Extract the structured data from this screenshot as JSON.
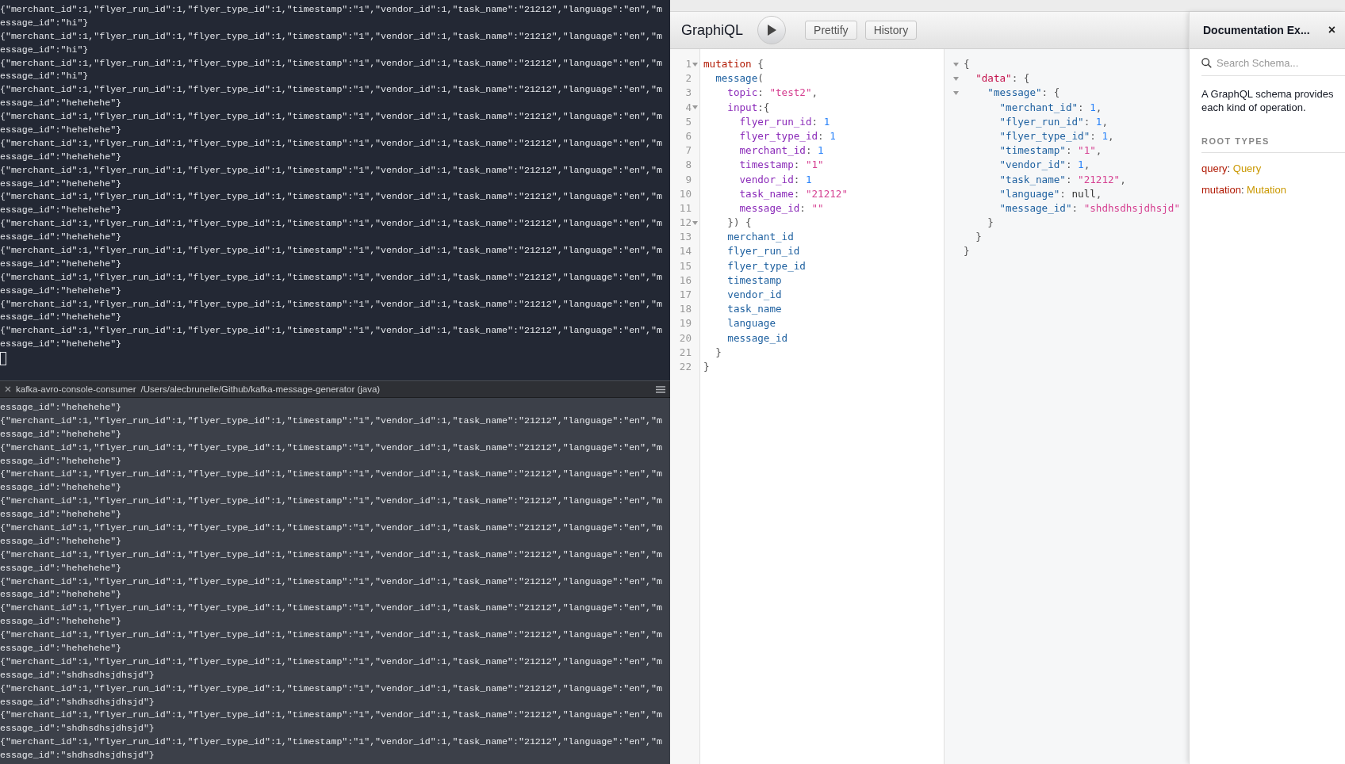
{
  "terminal": {
    "top_pane": {
      "lines": [
        "{\"merchant_id\":1,\"flyer_run_id\":1,\"flyer_type_id\":1,\"timestamp\":\"1\",\"vendor_id\":1,\"task_name\":\"21212\",\"language\":\"en\",\"m",
        "essage_id\":\"hi\"}",
        "{\"merchant_id\":1,\"flyer_run_id\":1,\"flyer_type_id\":1,\"timestamp\":\"1\",\"vendor_id\":1,\"task_name\":\"21212\",\"language\":\"en\",\"m",
        "essage_id\":\"hi\"}",
        "{\"merchant_id\":1,\"flyer_run_id\":1,\"flyer_type_id\":1,\"timestamp\":\"1\",\"vendor_id\":1,\"task_name\":\"21212\",\"language\":\"en\",\"m",
        "essage_id\":\"hi\"}",
        "{\"merchant_id\":1,\"flyer_run_id\":1,\"flyer_type_id\":1,\"timestamp\":\"1\",\"vendor_id\":1,\"task_name\":\"21212\",\"language\":\"en\",\"m",
        "essage_id\":\"hehehehe\"}",
        "{\"merchant_id\":1,\"flyer_run_id\":1,\"flyer_type_id\":1,\"timestamp\":\"1\",\"vendor_id\":1,\"task_name\":\"21212\",\"language\":\"en\",\"m",
        "essage_id\":\"hehehehe\"}",
        "{\"merchant_id\":1,\"flyer_run_id\":1,\"flyer_type_id\":1,\"timestamp\":\"1\",\"vendor_id\":1,\"task_name\":\"21212\",\"language\":\"en\",\"m",
        "essage_id\":\"hehehehe\"}",
        "{\"merchant_id\":1,\"flyer_run_id\":1,\"flyer_type_id\":1,\"timestamp\":\"1\",\"vendor_id\":1,\"task_name\":\"21212\",\"language\":\"en\",\"m",
        "essage_id\":\"hehehehe\"}",
        "{\"merchant_id\":1,\"flyer_run_id\":1,\"flyer_type_id\":1,\"timestamp\":\"1\",\"vendor_id\":1,\"task_name\":\"21212\",\"language\":\"en\",\"m",
        "essage_id\":\"hehehehe\"}",
        "{\"merchant_id\":1,\"flyer_run_id\":1,\"flyer_type_id\":1,\"timestamp\":\"1\",\"vendor_id\":1,\"task_name\":\"21212\",\"language\":\"en\",\"m",
        "essage_id\":\"hehehehe\"}",
        "{\"merchant_id\":1,\"flyer_run_id\":1,\"flyer_type_id\":1,\"timestamp\":\"1\",\"vendor_id\":1,\"task_name\":\"21212\",\"language\":\"en\",\"m",
        "essage_id\":\"hehehehe\"}",
        "{\"merchant_id\":1,\"flyer_run_id\":1,\"flyer_type_id\":1,\"timestamp\":\"1\",\"vendor_id\":1,\"task_name\":\"21212\",\"language\":\"en\",\"m",
        "essage_id\":\"hehehehe\"}",
        "{\"merchant_id\":1,\"flyer_run_id\":1,\"flyer_type_id\":1,\"timestamp\":\"1\",\"vendor_id\":1,\"task_name\":\"21212\",\"language\":\"en\",\"m",
        "essage_id\":\"hehehehe\"}",
        "{\"merchant_id\":1,\"flyer_run_id\":1,\"flyer_type_id\":1,\"timestamp\":\"1\",\"vendor_id\":1,\"task_name\":\"21212\",\"language\":\"en\",\"m",
        "essage_id\":\"hehehehe\"}"
      ]
    },
    "pane_header": {
      "title": "kafka-avro-console-consumer",
      "path": "/Users/alecbrunelle/Github/kafka-message-generator (java)"
    },
    "bottom_pane": {
      "lines": [
        "essage_id\":\"hehehehe\"}",
        "{\"merchant_id\":1,\"flyer_run_id\":1,\"flyer_type_id\":1,\"timestamp\":\"1\",\"vendor_id\":1,\"task_name\":\"21212\",\"language\":\"en\",\"m",
        "essage_id\":\"hehehehe\"}",
        "{\"merchant_id\":1,\"flyer_run_id\":1,\"flyer_type_id\":1,\"timestamp\":\"1\",\"vendor_id\":1,\"task_name\":\"21212\",\"language\":\"en\",\"m",
        "essage_id\":\"hehehehe\"}",
        "{\"merchant_id\":1,\"flyer_run_id\":1,\"flyer_type_id\":1,\"timestamp\":\"1\",\"vendor_id\":1,\"task_name\":\"21212\",\"language\":\"en\",\"m",
        "essage_id\":\"hehehehe\"}",
        "{\"merchant_id\":1,\"flyer_run_id\":1,\"flyer_type_id\":1,\"timestamp\":\"1\",\"vendor_id\":1,\"task_name\":\"21212\",\"language\":\"en\",\"m",
        "essage_id\":\"hehehehe\"}",
        "{\"merchant_id\":1,\"flyer_run_id\":1,\"flyer_type_id\":1,\"timestamp\":\"1\",\"vendor_id\":1,\"task_name\":\"21212\",\"language\":\"en\",\"m",
        "essage_id\":\"hehehehe\"}",
        "{\"merchant_id\":1,\"flyer_run_id\":1,\"flyer_type_id\":1,\"timestamp\":\"1\",\"vendor_id\":1,\"task_name\":\"21212\",\"language\":\"en\",\"m",
        "essage_id\":\"hehehehe\"}",
        "{\"merchant_id\":1,\"flyer_run_id\":1,\"flyer_type_id\":1,\"timestamp\":\"1\",\"vendor_id\":1,\"task_name\":\"21212\",\"language\":\"en\",\"m",
        "essage_id\":\"hehehehe\"}",
        "{\"merchant_id\":1,\"flyer_run_id\":1,\"flyer_type_id\":1,\"timestamp\":\"1\",\"vendor_id\":1,\"task_name\":\"21212\",\"language\":\"en\",\"m",
        "essage_id\":\"hehehehe\"}",
        "{\"merchant_id\":1,\"flyer_run_id\":1,\"flyer_type_id\":1,\"timestamp\":\"1\",\"vendor_id\":1,\"task_name\":\"21212\",\"language\":\"en\",\"m",
        "essage_id\":\"hehehehe\"}",
        "{\"merchant_id\":1,\"flyer_run_id\":1,\"flyer_type_id\":1,\"timestamp\":\"1\",\"vendor_id\":1,\"task_name\":\"21212\",\"language\":\"en\",\"m",
        "essage_id\":\"shdhsdhsjdhsjd\"}",
        "{\"merchant_id\":1,\"flyer_run_id\":1,\"flyer_type_id\":1,\"timestamp\":\"1\",\"vendor_id\":1,\"task_name\":\"21212\",\"language\":\"en\",\"m",
        "essage_id\":\"shdhsdhsjdhsjd\"}",
        "{\"merchant_id\":1,\"flyer_run_id\":1,\"flyer_type_id\":1,\"timestamp\":\"1\",\"vendor_id\":1,\"task_name\":\"21212\",\"language\":\"en\",\"m",
        "essage_id\":\"shdhsdhsjdhsjd\"}",
        "{\"merchant_id\":1,\"flyer_run_id\":1,\"flyer_type_id\":1,\"timestamp\":\"1\",\"vendor_id\":1,\"task_name\":\"21212\",\"language\":\"en\",\"m",
        "essage_id\":\"shdhsdhsjdhsjd\"}"
      ]
    }
  },
  "graphiql": {
    "title": "GraphiQL",
    "buttons": [
      "Prettify",
      "History"
    ],
    "query_editor": {
      "lines": [
        {
          "number": "1",
          "foldable": true,
          "tokens": [
            {
              "t": "mutation",
              "kind": "keyword"
            },
            {
              "t": " {",
              "kind": "punct"
            }
          ]
        },
        {
          "number": "2",
          "foldable": false,
          "tokens": [
            {
              "t": "  message",
              "kind": "property"
            },
            {
              "t": "(",
              "kind": "punct"
            }
          ]
        },
        {
          "number": "3",
          "foldable": false,
          "tokens": [
            {
              "t": "    topic",
              "kind": "attribute"
            },
            {
              "t": ": ",
              "kind": "punct"
            },
            {
              "t": "\"test2\"",
              "kind": "string"
            },
            {
              "t": ",",
              "kind": "punct"
            }
          ]
        },
        {
          "number": "4",
          "foldable": true,
          "tokens": [
            {
              "t": "    input",
              "kind": "attribute"
            },
            {
              "t": ":{",
              "kind": "punct"
            }
          ]
        },
        {
          "number": "5",
          "foldable": false,
          "tokens": [
            {
              "t": "      flyer_run_id",
              "kind": "attribute"
            },
            {
              "t": ": ",
              "kind": "punct"
            },
            {
              "t": "1",
              "kind": "number"
            }
          ]
        },
        {
          "number": "6",
          "foldable": false,
          "tokens": [
            {
              "t": "      flyer_type_id",
              "kind": "attribute"
            },
            {
              "t": ": ",
              "kind": "punct"
            },
            {
              "t": "1",
              "kind": "number"
            }
          ]
        },
        {
          "number": "7",
          "foldable": false,
          "tokens": [
            {
              "t": "      merchant_id",
              "kind": "attribute"
            },
            {
              "t": ": ",
              "kind": "punct"
            },
            {
              "t": "1",
              "kind": "number"
            }
          ]
        },
        {
          "number": "8",
          "foldable": false,
          "tokens": [
            {
              "t": "      timestamp",
              "kind": "attribute"
            },
            {
              "t": ": ",
              "kind": "punct"
            },
            {
              "t": "\"1\"",
              "kind": "string"
            }
          ]
        },
        {
          "number": "9",
          "foldable": false,
          "tokens": [
            {
              "t": "      vendor_id",
              "kind": "attribute"
            },
            {
              "t": ": ",
              "kind": "punct"
            },
            {
              "t": "1",
              "kind": "number"
            }
          ]
        },
        {
          "number": "10",
          "foldable": false,
          "tokens": [
            {
              "t": "      task_name",
              "kind": "attribute"
            },
            {
              "t": ": ",
              "kind": "punct"
            },
            {
              "t": "\"21212\"",
              "kind": "string"
            }
          ]
        },
        {
          "number": "11",
          "foldable": false,
          "tokens": [
            {
              "t": "      message_id",
              "kind": "attribute"
            },
            {
              "t": ": ",
              "kind": "punct"
            },
            {
              "t": "\"\"",
              "kind": "string"
            }
          ]
        },
        {
          "number": "12",
          "foldable": true,
          "tokens": [
            {
              "t": "    }) {",
              "kind": "punct"
            }
          ]
        },
        {
          "number": "13",
          "foldable": false,
          "tokens": [
            {
              "t": "    merchant_id",
              "kind": "property"
            }
          ]
        },
        {
          "number": "14",
          "foldable": false,
          "tokens": [
            {
              "t": "    flyer_run_id",
              "kind": "property"
            }
          ]
        },
        {
          "number": "15",
          "foldable": false,
          "tokens": [
            {
              "t": "    flyer_type_id",
              "kind": "property"
            }
          ]
        },
        {
          "number": "16",
          "foldable": false,
          "tokens": [
            {
              "t": "    timestamp",
              "kind": "property"
            }
          ]
        },
        {
          "number": "17",
          "foldable": false,
          "tokens": [
            {
              "t": "    vendor_id",
              "kind": "property"
            }
          ]
        },
        {
          "number": "18",
          "foldable": false,
          "tokens": [
            {
              "t": "    task_name",
              "kind": "property"
            }
          ]
        },
        {
          "number": "19",
          "foldable": false,
          "tokens": [
            {
              "t": "    language",
              "kind": "property"
            }
          ]
        },
        {
          "number": "20",
          "foldable": false,
          "tokens": [
            {
              "t": "    message_id",
              "kind": "property"
            }
          ]
        },
        {
          "number": "21",
          "foldable": false,
          "tokens": [
            {
              "t": "  }",
              "kind": "punct"
            }
          ]
        },
        {
          "number": "22",
          "foldable": false,
          "tokens": [
            {
              "t": "}",
              "kind": "punct"
            }
          ]
        }
      ]
    },
    "result_viewer": {
      "lines": [
        {
          "foldable": true,
          "tokens": [
            {
              "t": "{",
              "kind": "punct"
            }
          ]
        },
        {
          "foldable": true,
          "tokens": [
            {
              "t": "  \"data\"",
              "kind": "keytop"
            },
            {
              "t": ": {",
              "kind": "punct"
            }
          ]
        },
        {
          "foldable": true,
          "tokens": [
            {
              "t": "    \"message\"",
              "kind": "key"
            },
            {
              "t": ": {",
              "kind": "punct"
            }
          ]
        },
        {
          "foldable": false,
          "tokens": [
            {
              "t": "      \"merchant_id\"",
              "kind": "key"
            },
            {
              "t": ": ",
              "kind": "punct"
            },
            {
              "t": "1",
              "kind": "number"
            },
            {
              "t": ",",
              "kind": "punct"
            }
          ]
        },
        {
          "foldable": false,
          "tokens": [
            {
              "t": "      \"flyer_run_id\"",
              "kind": "key"
            },
            {
              "t": ": ",
              "kind": "punct"
            },
            {
              "t": "1",
              "kind": "number"
            },
            {
              "t": ",",
              "kind": "punct"
            }
          ]
        },
        {
          "foldable": false,
          "tokens": [
            {
              "t": "      \"flyer_type_id\"",
              "kind": "key"
            },
            {
              "t": ": ",
              "kind": "punct"
            },
            {
              "t": "1",
              "kind": "number"
            },
            {
              "t": ",",
              "kind": "punct"
            }
          ]
        },
        {
          "foldable": false,
          "tokens": [
            {
              "t": "      \"timestamp\"",
              "kind": "key"
            },
            {
              "t": ": ",
              "kind": "punct"
            },
            {
              "t": "\"1\"",
              "kind": "string"
            },
            {
              "t": ",",
              "kind": "punct"
            }
          ]
        },
        {
          "foldable": false,
          "tokens": [
            {
              "t": "      \"vendor_id\"",
              "kind": "key"
            },
            {
              "t": ": ",
              "kind": "punct"
            },
            {
              "t": "1",
              "kind": "number"
            },
            {
              "t": ",",
              "kind": "punct"
            }
          ]
        },
        {
          "foldable": false,
          "tokens": [
            {
              "t": "      \"task_name\"",
              "kind": "key"
            },
            {
              "t": ": ",
              "kind": "punct"
            },
            {
              "t": "\"21212\"",
              "kind": "string"
            },
            {
              "t": ",",
              "kind": "punct"
            }
          ]
        },
        {
          "foldable": false,
          "tokens": [
            {
              "t": "      \"language\"",
              "kind": "key"
            },
            {
              "t": ": ",
              "kind": "punct"
            },
            {
              "t": "null",
              "kind": "atom"
            },
            {
              "t": ",",
              "kind": "punct"
            }
          ]
        },
        {
          "foldable": false,
          "tokens": [
            {
              "t": "      \"message_id\"",
              "kind": "key"
            },
            {
              "t": ": ",
              "kind": "punct"
            },
            {
              "t": "\"shdhsdhsjdhsjd\"",
              "kind": "string"
            }
          ]
        },
        {
          "foldable": false,
          "tokens": [
            {
              "t": "    }",
              "kind": "punct"
            }
          ]
        },
        {
          "foldable": false,
          "tokens": [
            {
              "t": "  }",
              "kind": "punct"
            }
          ]
        },
        {
          "foldable": false,
          "tokens": [
            {
              "t": "}",
              "kind": "punct"
            }
          ]
        }
      ]
    },
    "doc_explorer": {
      "title": "Documentation Ex...",
      "close": "×",
      "search": {
        "placeholder": "Search Schema..."
      },
      "description_lines": [
        "A GraphQL schema provides",
        "each kind of operation."
      ],
      "section_title": "ROOT TYPES",
      "root_types": [
        {
          "name": "query",
          "separator": ": ",
          "type": "Query"
        },
        {
          "name": "mutation",
          "separator": ": ",
          "type": "Mutation"
        }
      ]
    }
  }
}
